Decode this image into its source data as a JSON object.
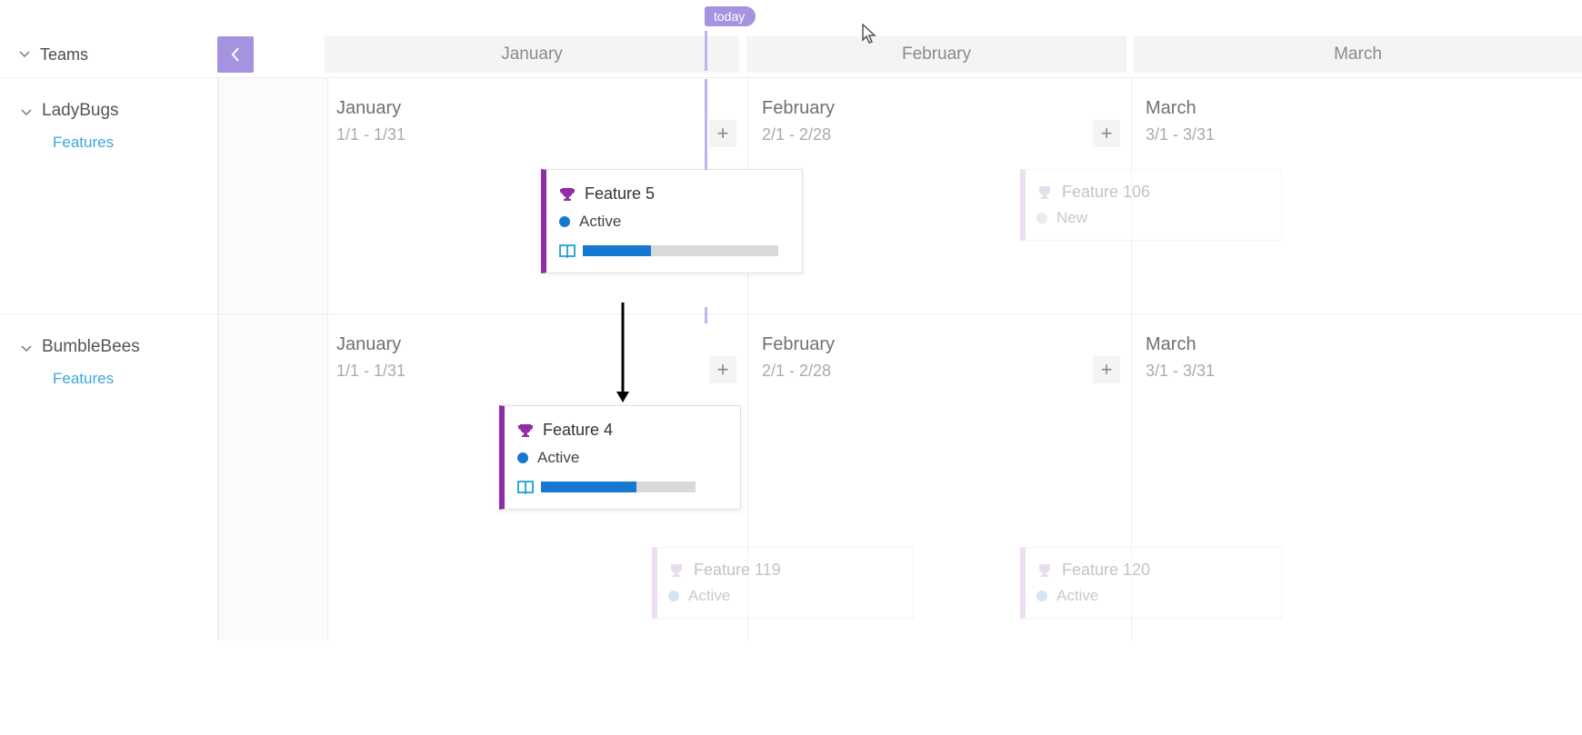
{
  "today_label": "today",
  "sidebar_header": "Teams",
  "month_headers": [
    "January",
    "February",
    "March"
  ],
  "teams": [
    {
      "name": "LadyBugs",
      "link": "Features",
      "columns": [
        {
          "label": "January",
          "range": "1/1 - 1/31"
        },
        {
          "label": "February",
          "range": "2/1 - 2/28"
        },
        {
          "label": "March",
          "range": "3/1 - 3/31"
        }
      ],
      "cards": {
        "feature5": {
          "title": "Feature 5",
          "status": "Active",
          "progress": 0.35
        },
        "feature106": {
          "title": "Feature 106",
          "status": "New"
        }
      }
    },
    {
      "name": "BumbleBees",
      "link": "Features",
      "columns": [
        {
          "label": "January",
          "range": "1/1 - 1/31"
        },
        {
          "label": "February",
          "range": "2/1 - 2/28"
        },
        {
          "label": "March",
          "range": "3/1 - 3/31"
        }
      ],
      "cards": {
        "feature4": {
          "title": "Feature 4",
          "status": "Active",
          "progress": 0.62
        },
        "feature119": {
          "title": "Feature 119",
          "status": "Active"
        },
        "feature120": {
          "title": "Feature 120",
          "status": "Active"
        }
      }
    }
  ]
}
